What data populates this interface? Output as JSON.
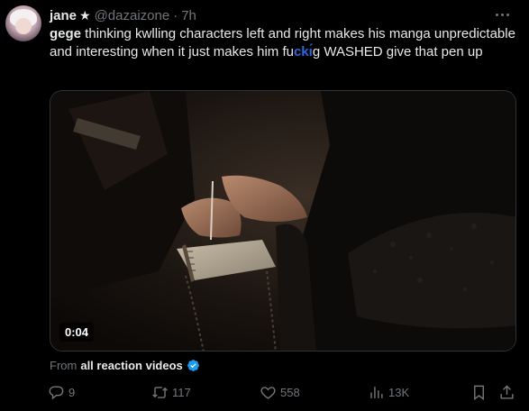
{
  "author": {
    "name": "jane",
    "badge": "★",
    "handle": "@dazaizone",
    "separator": "·",
    "time": "7h"
  },
  "tweet": {
    "part1_bold": "gege",
    "part2": " thinking kwlling characters left and right makes his manga unpredictable and interesting when it just makes him fu",
    "censored": "ckı́́",
    "part3": "g WASHED give that pen up"
  },
  "media": {
    "duration": "0:04"
  },
  "source": {
    "from_label": "From",
    "account": "all reaction videos"
  },
  "actions": {
    "replies": "9",
    "reposts": "117",
    "likes": "558",
    "views": "13K"
  },
  "colors": {
    "background": "#000000",
    "text": "#e7e9ea",
    "muted": "#71767b",
    "verified": "#1d9bf0",
    "censor": "#2e68d8"
  },
  "icons": [
    "more-icon",
    "verified-icon",
    "reply-icon",
    "repost-icon",
    "like-icon",
    "views-icon",
    "bookmark-icon",
    "share-icon"
  ]
}
